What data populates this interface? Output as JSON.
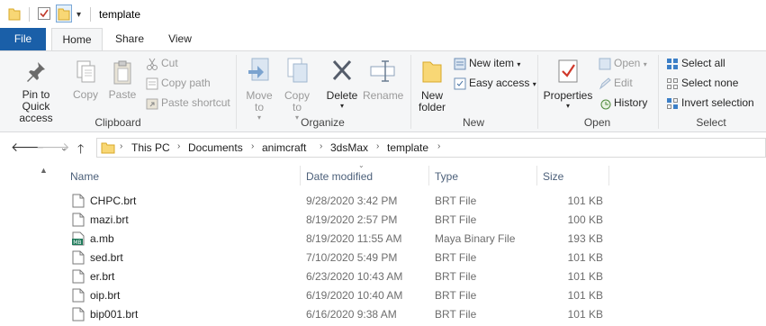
{
  "window": {
    "title": "template"
  },
  "tabs": {
    "file": "File",
    "home": "Home",
    "share": "Share",
    "view": "View"
  },
  "ribbon": {
    "clipboard": {
      "label": "Clipboard",
      "pin": "Pin to Quick access",
      "copy": "Copy",
      "paste": "Paste",
      "cut": "Cut",
      "copy_path": "Copy path",
      "paste_shortcut": "Paste shortcut"
    },
    "organize": {
      "label": "Organize",
      "move_to": "Move to",
      "copy_to": "Copy to",
      "delete": "Delete",
      "rename": "Rename"
    },
    "new": {
      "label": "New",
      "new_folder": "New folder",
      "new_item": "New item",
      "easy_access": "Easy access"
    },
    "open": {
      "label": "Open",
      "properties": "Properties",
      "open": "Open",
      "edit": "Edit",
      "history": "History"
    },
    "select": {
      "label": "Select",
      "select_all": "Select all",
      "select_none": "Select none",
      "invert": "Invert selection"
    }
  },
  "address": {
    "crumbs": [
      "This PC",
      "Documents",
      "animcraft",
      "3dsMax",
      "template"
    ]
  },
  "columns": {
    "name": "Name",
    "date": "Date modified",
    "type": "Type",
    "size": "Size"
  },
  "files": [
    {
      "name": "CHPC.brt",
      "date": "9/28/2020 3:42 PM",
      "type": "BRT File",
      "size": "101 KB",
      "icon": "document-icon"
    },
    {
      "name": "mazi.brt",
      "date": "8/19/2020 2:57 PM",
      "type": "BRT File",
      "size": "100 KB",
      "icon": "document-icon"
    },
    {
      "name": "a.mb",
      "date": "8/19/2020 11:55 AM",
      "type": "Maya Binary File",
      "size": "193 KB",
      "icon": "maya-binary-icon"
    },
    {
      "name": "sed.brt",
      "date": "7/10/2020 5:49 PM",
      "type": "BRT File",
      "size": "101 KB",
      "icon": "document-icon"
    },
    {
      "name": "er.brt",
      "date": "6/23/2020 10:43 AM",
      "type": "BRT File",
      "size": "101 KB",
      "icon": "document-icon"
    },
    {
      "name": "oip.brt",
      "date": "6/19/2020 10:40 AM",
      "type": "BRT File",
      "size": "101 KB",
      "icon": "document-icon"
    },
    {
      "name": "bip001.brt",
      "date": "6/16/2020 9:38 AM",
      "type": "BRT File",
      "size": "101 KB",
      "icon": "document-icon"
    }
  ],
  "mb_badge": "MB"
}
